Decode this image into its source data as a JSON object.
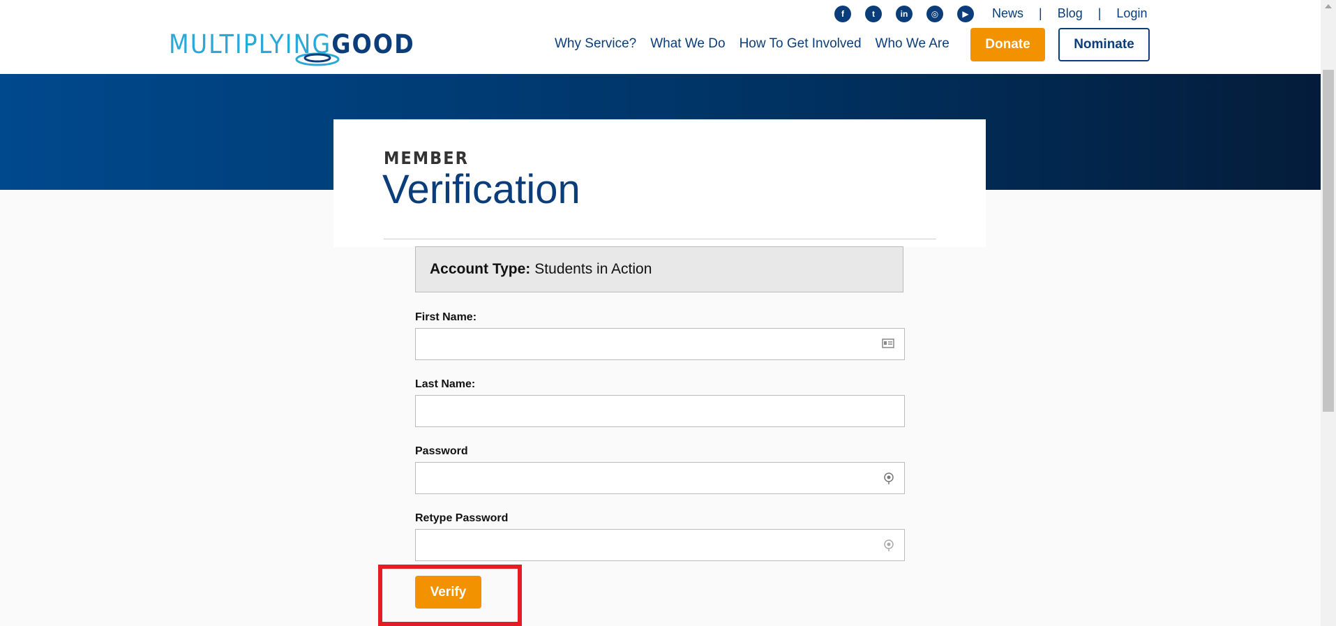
{
  "header": {
    "logo": {
      "light": "MULTIPLYING",
      "dark": "GOOD"
    },
    "social": [
      {
        "name": "facebook-icon",
        "glyph": "f"
      },
      {
        "name": "twitter-icon",
        "glyph": "t"
      },
      {
        "name": "linkedin-icon",
        "glyph": "in"
      },
      {
        "name": "instagram-icon",
        "glyph": "◎"
      },
      {
        "name": "youtube-icon",
        "glyph": "▶"
      }
    ],
    "top_links": {
      "news": "News",
      "sep1": "|",
      "blog": "Blog",
      "sep2": "|",
      "login": "Login"
    },
    "nav": {
      "why": "Why Service?",
      "what": "What We Do",
      "how": "How To Get Involved",
      "who": "Who We Are"
    },
    "donate": "Donate",
    "nominate": "Nominate"
  },
  "page": {
    "eyebrow": "MEMBER",
    "title": "Verification"
  },
  "account": {
    "label": "Account Type:",
    "value": "Students in Action"
  },
  "form": {
    "first_name": {
      "label": "First Name:",
      "value": ""
    },
    "last_name": {
      "label": "Last Name:",
      "value": ""
    },
    "password": {
      "label": "Password",
      "value": ""
    },
    "retype_password": {
      "label": "Retype Password",
      "value": ""
    },
    "submit": "Verify"
  },
  "colors": {
    "brand_blue": "#0a3d7a",
    "accent_orange": "#f39200",
    "highlight_red": "#e51c23"
  }
}
